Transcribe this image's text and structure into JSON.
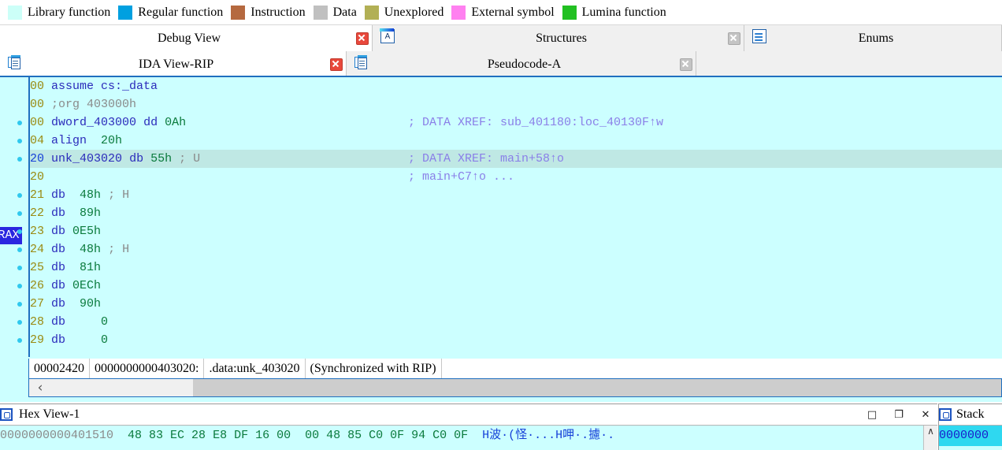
{
  "legend": {
    "items": [
      {
        "label": "Library function",
        "color": "#ccfff8"
      },
      {
        "label": "Regular function",
        "color": "#00a0e0"
      },
      {
        "label": "Instruction",
        "color": "#b5693f"
      },
      {
        "label": "Data",
        "color": "#c0c0c0"
      },
      {
        "label": "Unexplored",
        "color": "#b2b055"
      },
      {
        "label": "External symbol",
        "color": "#ff80f0"
      },
      {
        "label": "Lumina function",
        "color": "#22c022"
      }
    ]
  },
  "tabs_row1": [
    {
      "label": "Debug View",
      "icon": "",
      "active": true,
      "close": "red"
    },
    {
      "label": "Structures",
      "icon": "structures-icon",
      "active": false,
      "close": "grey"
    },
    {
      "label": "Enums",
      "icon": "enums-icon",
      "active": false,
      "close": ""
    }
  ],
  "tabs_row2": [
    {
      "label": "IDA View-RIP",
      "icon": "document-icon",
      "active": true,
      "close": "red"
    },
    {
      "label": "Pseudocode-A",
      "icon": "document-icon",
      "active": false,
      "close": "grey"
    }
  ],
  "disassembly": {
    "lines": [
      {
        "addr": "00",
        "dot": false,
        "hl": false,
        "text": "assume cs:_data",
        "kind": "directive",
        "comment": ""
      },
      {
        "addr": "00",
        "dot": false,
        "hl": false,
        "text": ";org 403000h",
        "kind": "comment",
        "comment": ""
      },
      {
        "addr": "00",
        "dot": true,
        "hl": false,
        "name": "dword_403000",
        "mnem": "dd",
        "operand": "0Ah",
        "comment": "; DATA XREF: sub_401180:loc_40130F↑w"
      },
      {
        "addr": "04",
        "dot": true,
        "hl": false,
        "mnem": "align",
        "operand": "20h",
        "comment": ""
      },
      {
        "addr": "20",
        "dot": true,
        "hl": true,
        "name": "unk_403020",
        "mnem": "db",
        "operand": "55h",
        "trail": "; U",
        "comment": "; DATA XREF: main+58↑o"
      },
      {
        "addr": "20",
        "dot": false,
        "hl": false,
        "text": "",
        "comment": "; main+C7↑o ..."
      },
      {
        "addr": "21",
        "dot": true,
        "hl": false,
        "mnem": "db",
        "operand": "48h",
        "trail": "; H",
        "comment": ""
      },
      {
        "addr": "22",
        "dot": true,
        "hl": false,
        "mnem": "db",
        "operand": "89h",
        "trail": "",
        "comment": ""
      },
      {
        "addr": "23",
        "dot": true,
        "hl": false,
        "mnem": "db",
        "operand": "0E5h",
        "trail": "",
        "comment": ""
      },
      {
        "addr": "24",
        "dot": true,
        "hl": false,
        "mnem": "db",
        "operand": "48h",
        "trail": "; H",
        "comment": ""
      },
      {
        "addr": "25",
        "dot": true,
        "hl": false,
        "mnem": "db",
        "operand": "81h",
        "trail": "",
        "comment": ""
      },
      {
        "addr": "26",
        "dot": true,
        "hl": false,
        "mnem": "db",
        "operand": "0ECh",
        "trail": "",
        "comment": ""
      },
      {
        "addr": "27",
        "dot": true,
        "hl": false,
        "mnem": "db",
        "operand": "90h",
        "trail": "",
        "comment": ""
      },
      {
        "addr": "28",
        "dot": true,
        "hl": false,
        "mnem": "db",
        "operand": "0",
        "trail": "",
        "comment": ""
      },
      {
        "addr": "29",
        "dot": true,
        "hl": false,
        "mnem": "db",
        "operand": "0",
        "trail": "",
        "comment": ""
      }
    ],
    "register_marker": "RAX",
    "status": {
      "offset": "00002420",
      "address": "0000000000403020:",
      "location": ".data:unk_403020",
      "sync": "(Synchronized with RIP)"
    },
    "scroll_left_arrow": "‹"
  },
  "hexview": {
    "title": "Hex View-1",
    "icon": "hex-icon",
    "window_buttons": [
      "□",
      "❐",
      "✕"
    ],
    "scroll_up_arrow": "∧",
    "rows": [
      {
        "address": "0000000000401510",
        "bytes": "48 83 EC 28 E8 DF 16 00  00 48 85 C0 0F 94 C0 0F",
        "ascii": "H波·(怪·...H呷·.攄·."
      }
    ]
  },
  "stack": {
    "title": "Stack",
    "icon": "stack-icon",
    "rows": [
      "0000000"
    ]
  }
}
